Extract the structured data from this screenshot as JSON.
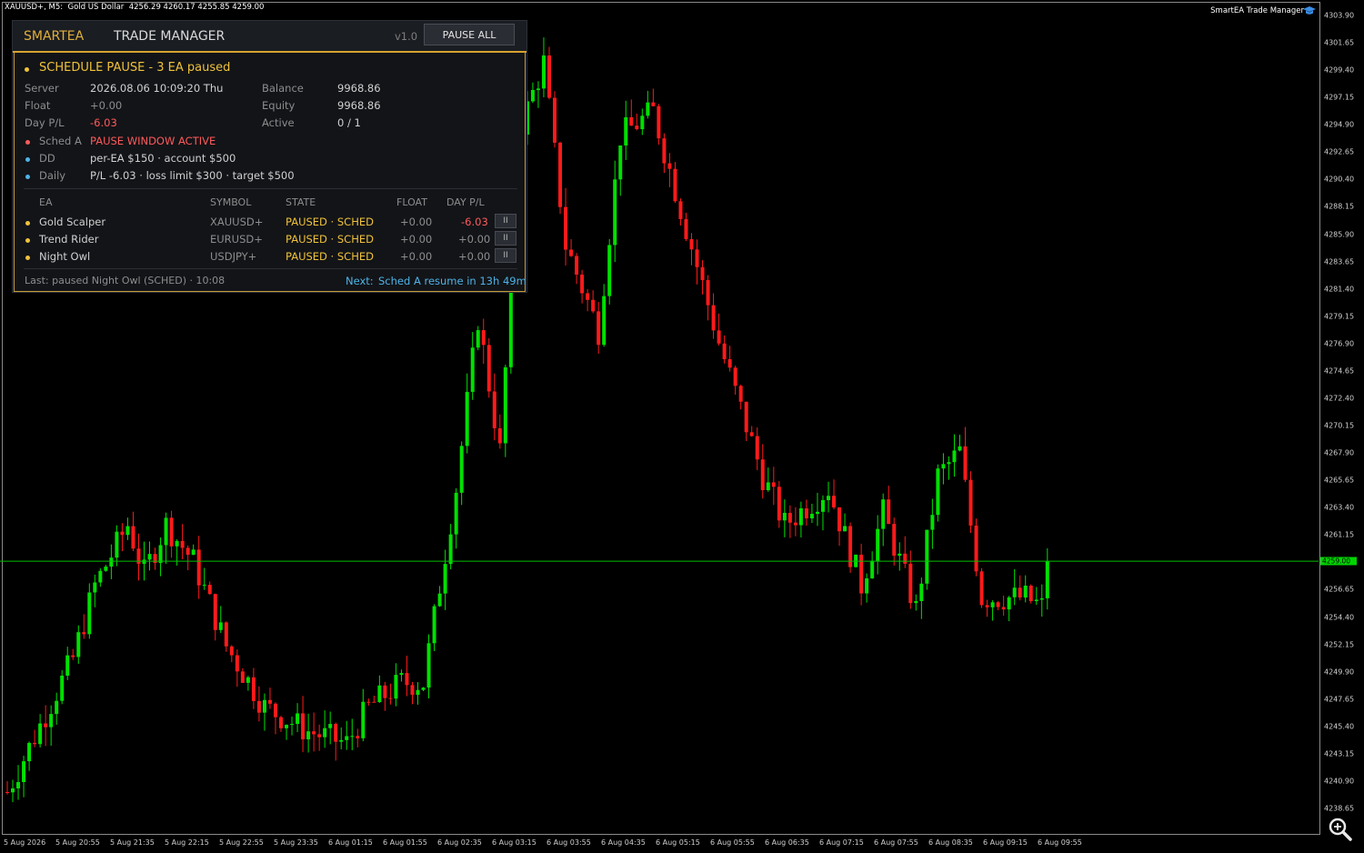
{
  "chart": {
    "symbol_info": "XAUUSD+, M5:  Gold US Dollar  4256.29 4260.17 4255.85 4259.00",
    "indicator_label": "SmartEA Trade Manager",
    "price_ticks": [
      "4303.90",
      "4301.65",
      "4299.40",
      "4297.15",
      "4294.90",
      "4292.65",
      "4290.40",
      "4288.15",
      "4285.90",
      "4283.65",
      "4281.40",
      "4279.15",
      "4276.90",
      "4274.65",
      "4272.40",
      "4270.15",
      "4267.90",
      "4265.65",
      "4263.40",
      "4261.15",
      "4256.65",
      "4254.40",
      "4252.15",
      "4249.90",
      "4247.65",
      "4245.40",
      "4243.15",
      "4240.90",
      "4238.65"
    ],
    "current_price": "4259.00",
    "time_ticks": [
      "5 Aug 2026",
      "5 Aug 20:55",
      "5 Aug 21:35",
      "5 Aug 22:15",
      "5 Aug 22:55",
      "5 Aug 23:35",
      "6 Aug 01:15",
      "6 Aug 01:55",
      "6 Aug 02:35",
      "6 Aug 03:15",
      "6 Aug 03:55",
      "6 Aug 04:35",
      "6 Aug 05:15",
      "6 Aug 05:55",
      "6 Aug 06:35",
      "6 Aug 07:15",
      "6 Aug 07:55",
      "6 Aug 08:35",
      "6 Aug 09:15",
      "6 Aug 09:55"
    ],
    "colors": {
      "bull": "#00e000",
      "bear": "#ff1a1a",
      "price_line": "#00c000"
    }
  },
  "panel": {
    "brand": "SMARTEA",
    "title": "TRADE MANAGER",
    "version": "v1.0",
    "pause_all_label": "PAUSE ALL",
    "status": "SCHEDULE PAUSE - 3 EA paused",
    "server_label": "Server",
    "server_value": "2026.08.06 10:09:20 Thu",
    "float_label": "Float",
    "float_value": "+0.00",
    "daypl_label": "Day P/L",
    "daypl_value": "-6.03",
    "balance_label": "Balance",
    "balance_value": "9968.86",
    "equity_label": "Equity",
    "equity_value": "9968.86",
    "active_label": "Active",
    "active_value": "0 / 1",
    "sched_label": "Sched A",
    "sched_value": "PAUSE WINDOW ACTIVE",
    "dd_label": "DD",
    "dd_value": "per-EA $150  ·  account $500",
    "daily_label": "Daily",
    "daily_value": "P/L -6.03  ·  loss limit $300  ·  target $500",
    "table": {
      "headers": [
        "EA",
        "SYMBOL",
        "STATE",
        "FLOAT",
        "DAY P/L"
      ],
      "rows": [
        {
          "ea": "Gold Scalper",
          "symbol": "XAUUSD+",
          "state": "PAUSED · SCHED",
          "float": "+0.00",
          "daypl": "-6.03",
          "btn": "II"
        },
        {
          "ea": "Trend Rider",
          "symbol": "EURUSD+",
          "state": "PAUSED · SCHED",
          "float": "+0.00",
          "daypl": "+0.00",
          "btn": "II"
        },
        {
          "ea": "Night Owl",
          "symbol": "USDJPY+",
          "state": "PAUSED · SCHED",
          "float": "+0.00",
          "daypl": "+0.00",
          "btn": "II"
        }
      ]
    },
    "last": "Last:  paused Night Owl (SCHED) · 10:08",
    "next_label": "Next:",
    "next_value": "Sched A resume in 13h 49m"
  }
}
